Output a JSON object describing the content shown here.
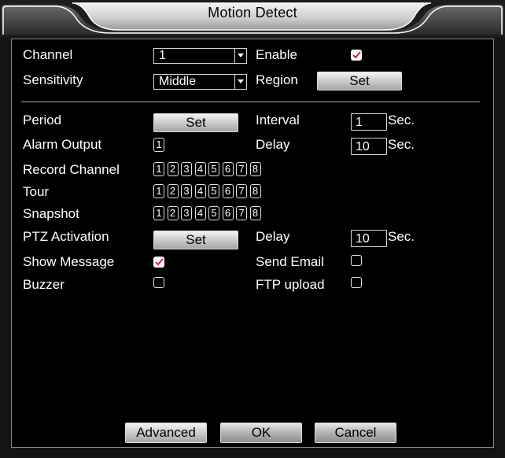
{
  "dialog": {
    "title": "Motion Detect"
  },
  "labels": {
    "channel": "Channel",
    "enable": "Enable",
    "sensitivity": "Sensitivity",
    "region": "Region",
    "period": "Period",
    "interval": "Interval",
    "alarm_output": "Alarm Output",
    "delay": "Delay",
    "record_channel": "Record Channel",
    "tour": "Tour",
    "snapshot": "Snapshot",
    "ptz_activation": "PTZ Activation",
    "ptz_delay": "Delay",
    "show_message": "Show Message",
    "send_email": "Send Email",
    "buzzer": "Buzzer",
    "ftp_upload": "FTP upload"
  },
  "values": {
    "channel": "1",
    "sensitivity": "Middle",
    "interval": "1",
    "delay": "10",
    "ptz_delay": "10",
    "alarm_output": "1",
    "sec": "Sec."
  },
  "checks": {
    "enable": true,
    "show_message": true,
    "send_email": false,
    "buzzer": false,
    "ftp_upload": false
  },
  "channels": [
    "1",
    "2",
    "3",
    "4",
    "5",
    "6",
    "7",
    "8"
  ],
  "buttons": {
    "set": "Set",
    "advanced": "Advanced",
    "ok": "OK",
    "cancel": "Cancel"
  },
  "colors": {
    "background": "#000000",
    "check_mark": "#e8112d",
    "button_face": "#d2d2d2"
  }
}
